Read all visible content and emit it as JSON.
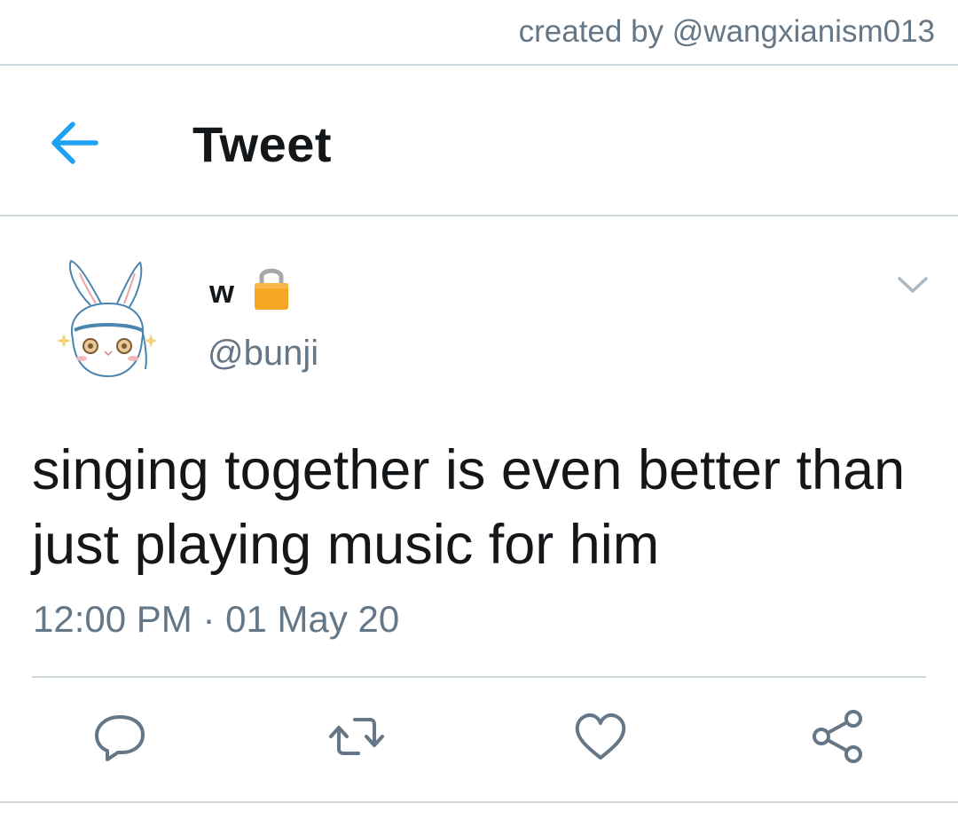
{
  "watermark": "created by @wangxianism013",
  "header": {
    "title": "Tweet",
    "back_icon": "arrow-left-icon"
  },
  "author": {
    "display_name": "w",
    "handle": "@bunji",
    "protected_icon": "lock-icon",
    "avatar": "bunny-avatar"
  },
  "tweet": {
    "text": "singing together is even better than just playing music for him",
    "timestamp": "12:00 PM · 01 May 20"
  },
  "actions": [
    {
      "icon": "reply-icon"
    },
    {
      "icon": "retweet-icon"
    },
    {
      "icon": "like-icon"
    },
    {
      "icon": "share-icon"
    }
  ],
  "colors": {
    "accent": "#1da1f2",
    "text": "#14171a",
    "secondary": "#657786",
    "divider": "#ccd6dd",
    "lock": "#f5a623"
  }
}
